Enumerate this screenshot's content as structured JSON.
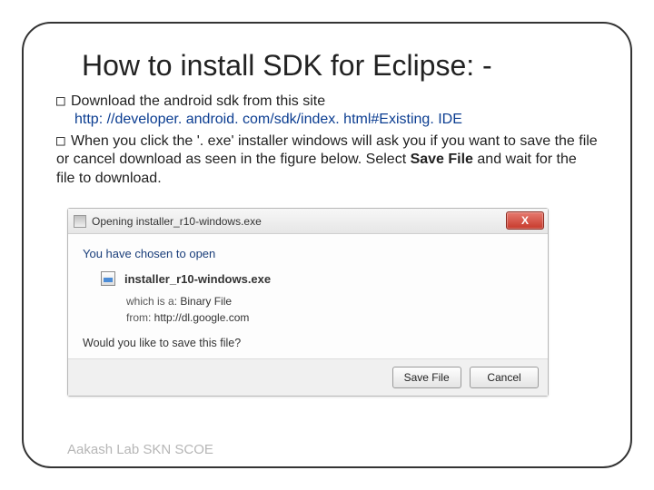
{
  "title": "How to install SDK for Eclipse: -",
  "bullets": {
    "item1_prefix": "□ ",
    "item1_text": "Download the android sdk  from this  site",
    "link": "http: //developer. android. com/sdk/index. html#Existing. IDE",
    "item2_prefix": "□ ",
    "item2_text_a": "When you click the '. exe' installer windows will ask you if you want to save the file or cancel download as seen in the figure below. Select ",
    "item2_bold": "Save File",
    "item2_text_b": " and wait for the file to download."
  },
  "dialog": {
    "title": "Opening installer_r10-windows.exe",
    "close": "X",
    "chosen": "You have chosen to open",
    "filename": "installer_r10-windows.exe",
    "which_label": "which is a:  ",
    "which_value": "Binary File",
    "from_label": "from:  ",
    "from_value": "http://dl.google.com",
    "ask": "Would you like to save this file?",
    "save": "Save File",
    "cancel": "Cancel"
  },
  "footer": "Aakash Lab SKN SCOE"
}
